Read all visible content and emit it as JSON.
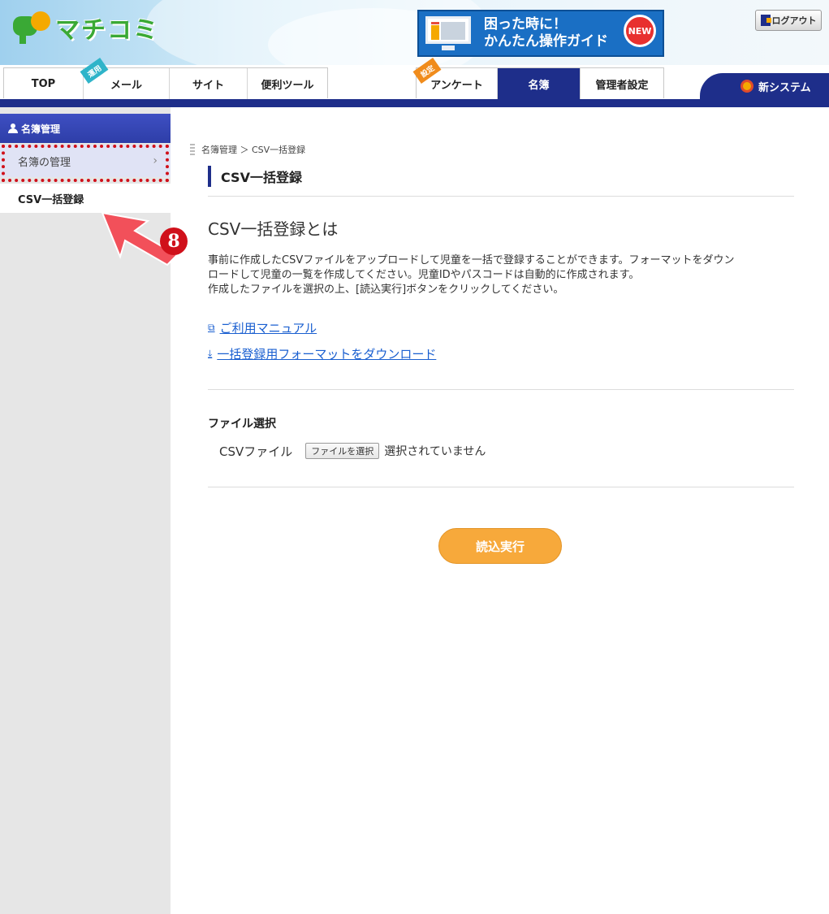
{
  "header": {
    "logo_text": "マチコミ",
    "guide_line1": "困った時に！",
    "guide_line2": "かんたん操作ガイド",
    "guide_badge": "NEW",
    "logout_label": "ログアウト",
    "new_system_label": "新システム"
  },
  "nav": {
    "tabs": [
      {
        "label": "TOP"
      },
      {
        "label": "メール",
        "ribbon": "運用"
      },
      {
        "label": "サイト"
      },
      {
        "label": "便利ツール"
      },
      {
        "label": "アンケート",
        "ribbon": "設定"
      },
      {
        "label": "名簿",
        "active": true
      },
      {
        "label": "管理者設定"
      }
    ]
  },
  "sidebar": {
    "header": "名簿管理",
    "items": [
      {
        "label": "名簿の管理",
        "chevron": "›"
      },
      {
        "label": "CSV一括登録"
      }
    ],
    "step_number": "8"
  },
  "main": {
    "breadcrumb": "名簿管理 ＞ CSV一括登録",
    "page_title": "CSV一括登録",
    "section_heading": "CSV一括登録とは",
    "desc_line1": "事前に作成したCSVファイルをアップロードして児童を一括で登録することができます。フォーマットをダウン",
    "desc_line2": "ロードして児童の一覧を作成してください。児童IDやパスコードは自動的に作成されます。",
    "desc_line3": "作成したファイルを選択の上、[読込実行]ボタンをクリックしてください。",
    "link_manual": "ご利用マニュアル",
    "link_format": "一括登録用フォーマットをダウンロード",
    "file_section_heading": "ファイル選択",
    "file_label": "CSVファイル",
    "file_button": "ファイルを選択",
    "file_status": "選択されていません",
    "submit_label": "読込実行"
  },
  "colors": {
    "nav_blue": "#1e2e8a",
    "highlight_red": "#d0101a",
    "link_blue": "#1a5fd0",
    "button_orange": "#f7a93b"
  }
}
